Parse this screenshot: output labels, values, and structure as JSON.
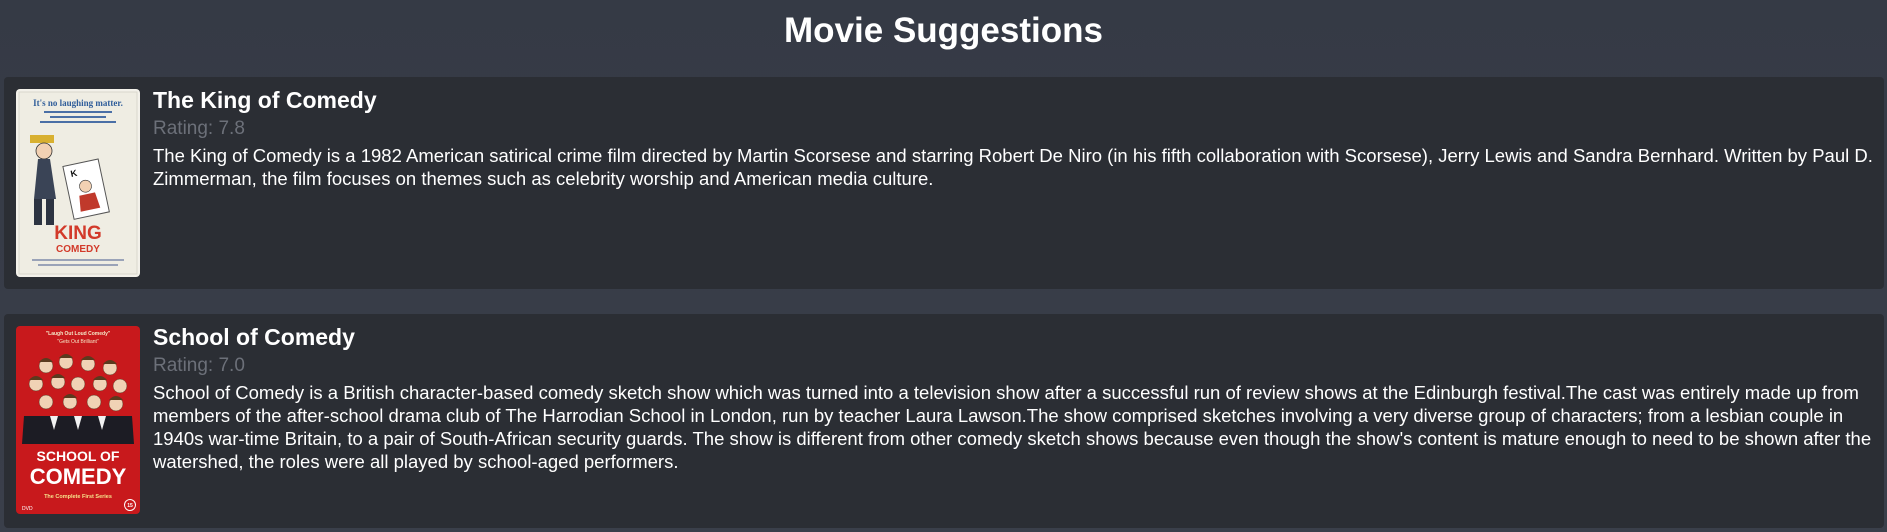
{
  "page": {
    "title": "Movie Suggestions"
  },
  "movies": [
    {
      "title": "The King of Comedy",
      "rating_label": "Rating: ",
      "rating_value": "7.8",
      "description": "The King of Comedy is a 1982 American satirical crime film directed by Martin Scorsese and starring Robert De Niro (in his fifth collaboration with Scorsese), Jerry Lewis and Sandra Bernhard. Written by Paul D. Zimmerman, the film focuses on themes such as celebrity worship and American media culture.",
      "poster": {
        "tagline": "It's no laughing matter.",
        "wordmark_top": "KING",
        "wordmark_bottom": "COMEDY"
      }
    },
    {
      "title": "School of Comedy",
      "rating_label": "Rating: ",
      "rating_value": "7.0",
      "description": "School of Comedy is a British character-based comedy sketch show which was turned into a television show after a successful run of review shows at the Edinburgh festival.The cast was entirely made up from members of the after-school drama club of The Harrodian School in London, run by teacher Laura Lawson.The show comprised sketches involving a very diverse group of characters; from a lesbian couple in 1940s war-time Britain, to a pair of South-African security guards. The show is different from other comedy sketch shows because even though the show's content is mature enough to need to be shown after the watershed, the roles were all played by school-aged performers.",
      "poster": {
        "quote_top": "\"Laugh Out Loud Comedy\"",
        "quote_sub": "\"Gets Out Brilliant\"",
        "wordmark_top": "SCHOOL OF",
        "wordmark_bottom": "COMEDY",
        "series_text": "The Complete First Series",
        "dvd_text": "DVD",
        "age_rating": "15"
      }
    }
  ],
  "colors": {
    "background": "#363b46",
    "card": "#2b2e34",
    "rating_text": "#6c7079",
    "poster_red": "#c8191c"
  }
}
